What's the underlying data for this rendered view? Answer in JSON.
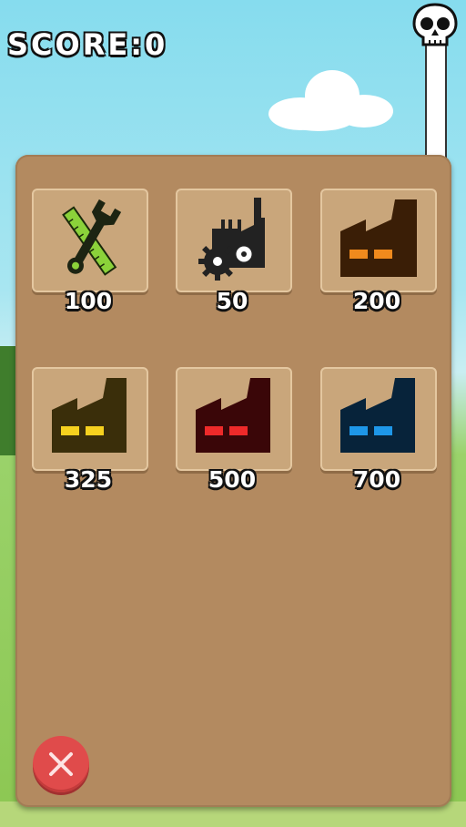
{
  "hud": {
    "score_label": "SCORE:",
    "score_value": "0"
  },
  "shop": {
    "items": [
      {
        "icon": "wrench-ruler-icon",
        "price": "100"
      },
      {
        "icon": "factory-gears-icon",
        "price": "50"
      },
      {
        "icon": "factory-orange-icon",
        "price": "200",
        "color": "#f08a1d"
      },
      {
        "icon": "factory-yellow-icon",
        "price": "325",
        "color": "#f6d11f"
      },
      {
        "icon": "factory-red-icon",
        "price": "500",
        "color": "#ee2a2a"
      },
      {
        "icon": "factory-blue-icon",
        "price": "700",
        "color": "#1e97e8"
      }
    ],
    "close_icon": "close-x-icon"
  },
  "colors": {
    "panel": "#b38a60",
    "tile": "#c9a67b",
    "close_button": "#e04b4b"
  }
}
